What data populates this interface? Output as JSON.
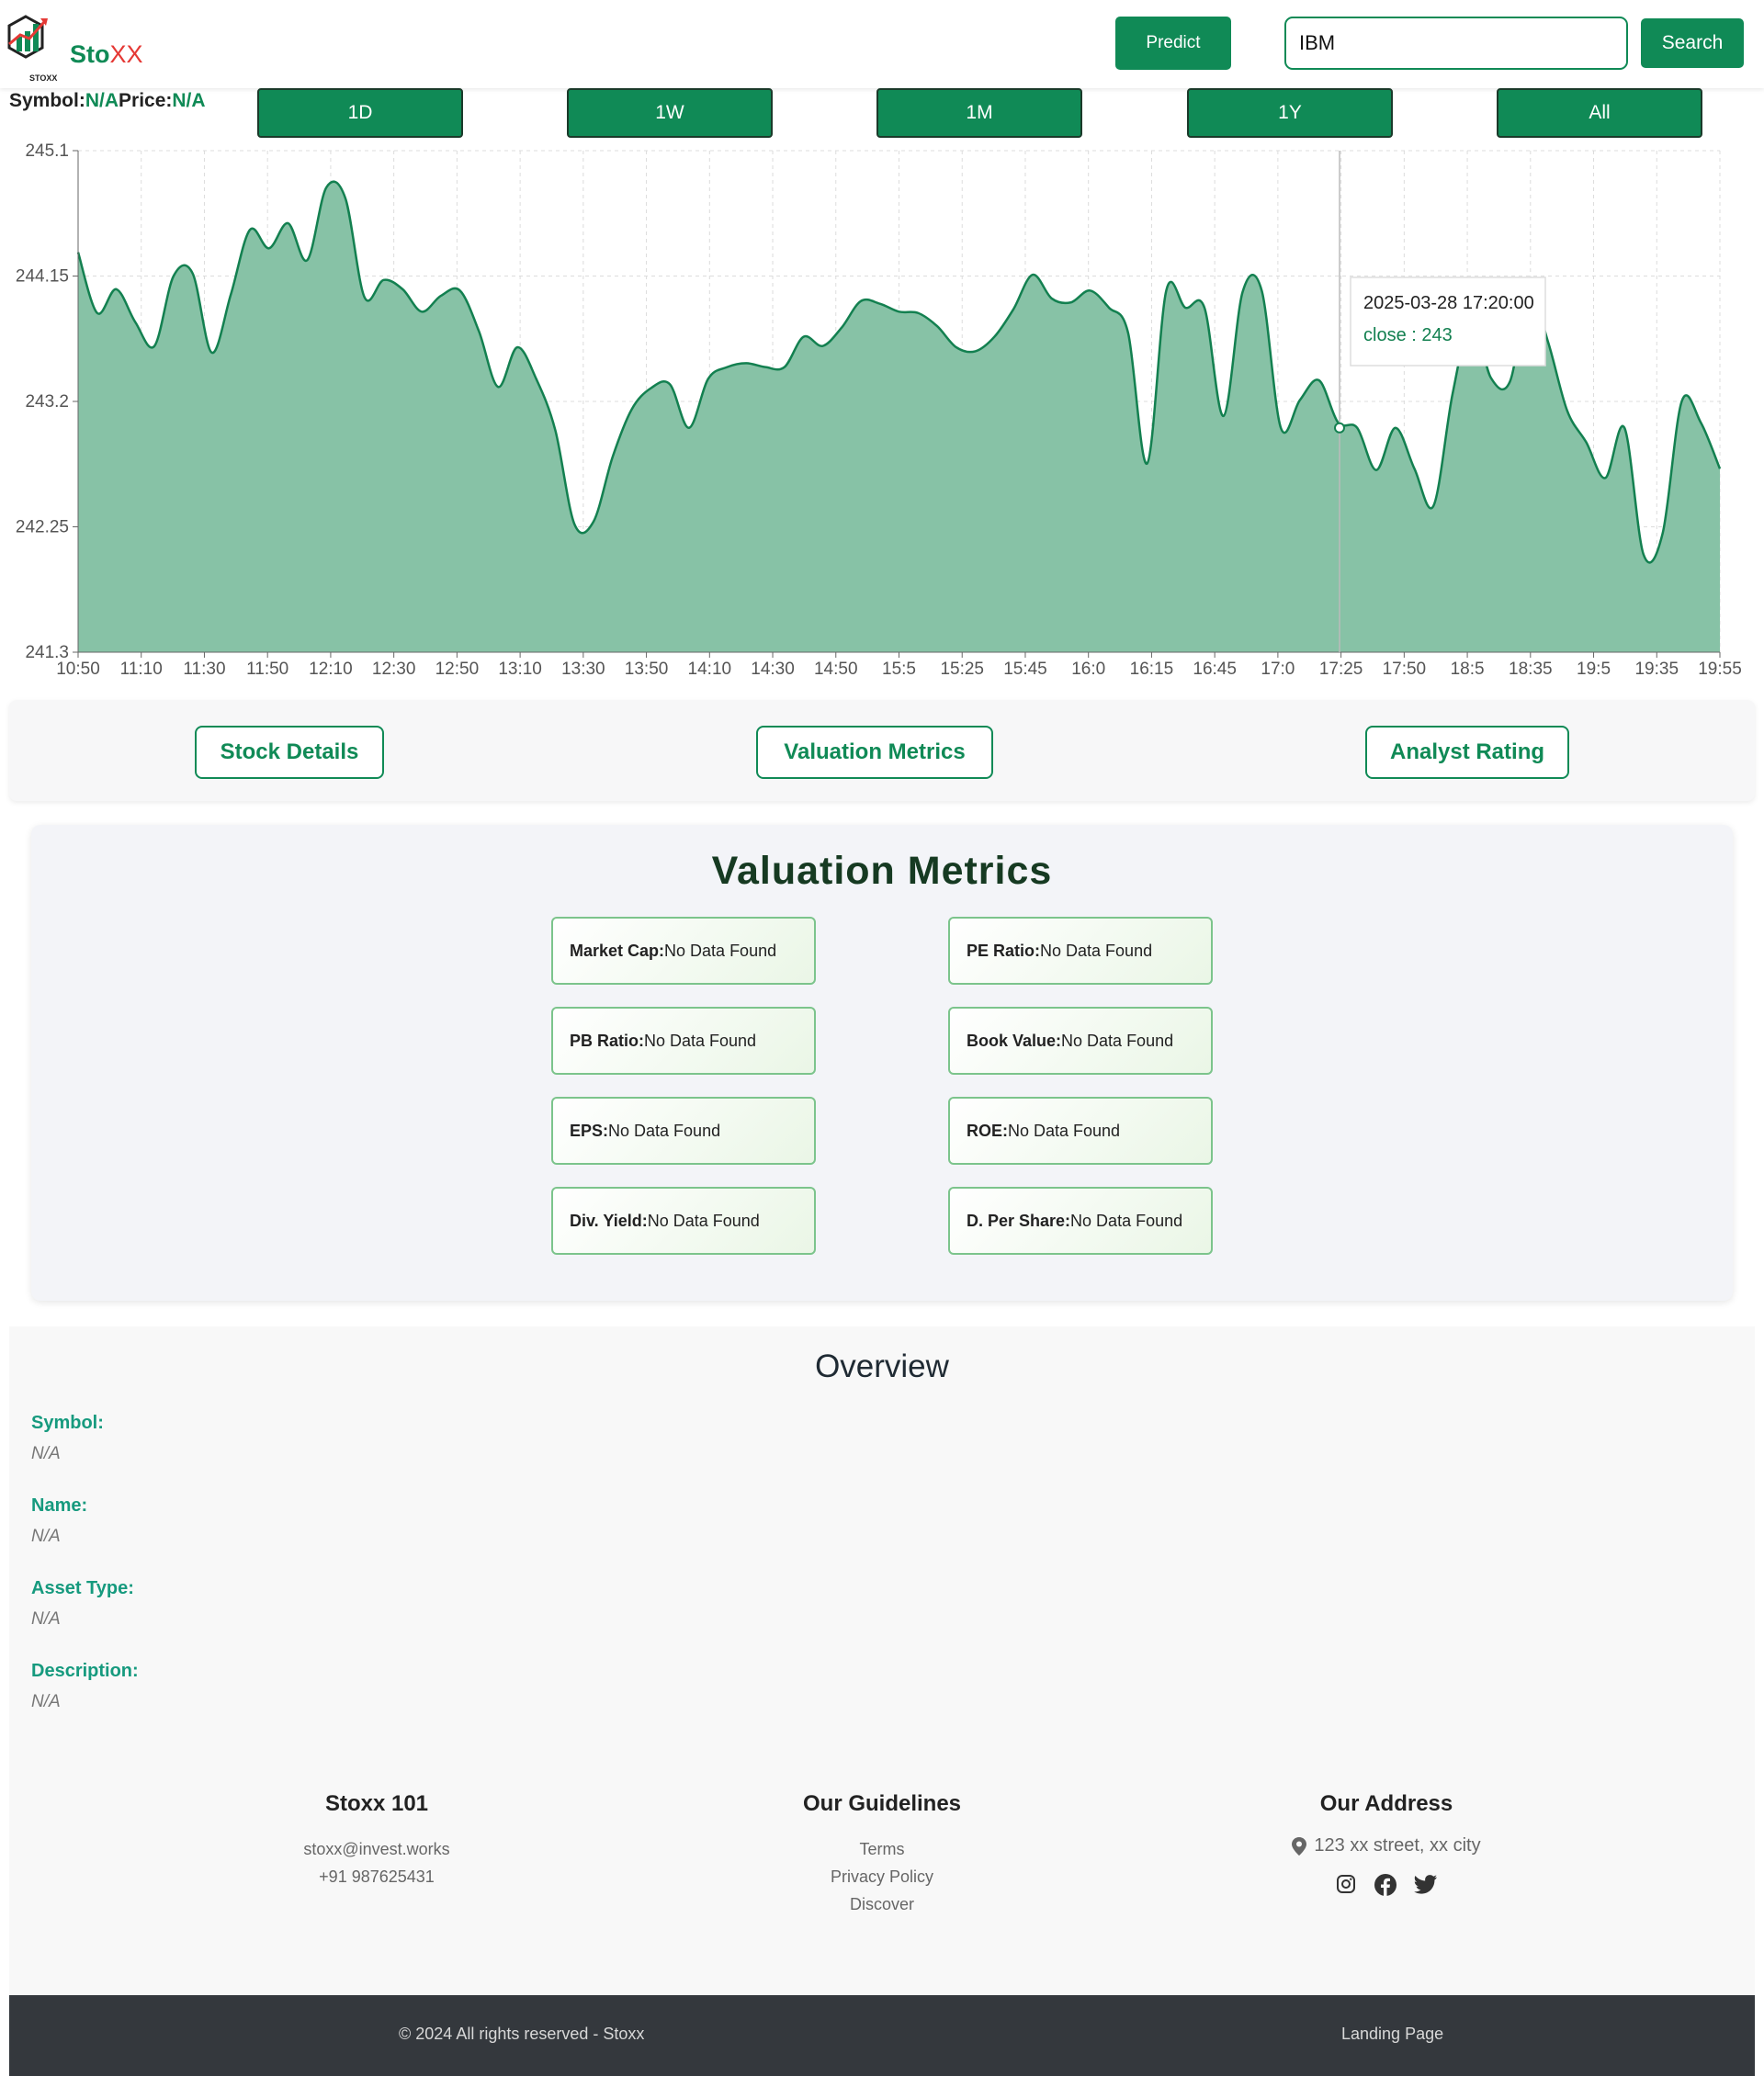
{
  "header": {
    "logo_text_a": "Sto",
    "logo_text_b": "XX",
    "logo_sub": "STOXX",
    "predict_label": "Predict",
    "search_value": "IBM",
    "search_label": "Search"
  },
  "quote": {
    "symbol_label": "Symbol:",
    "symbol_value": "N/A",
    "price_label": "Price:",
    "price_value": "N/A"
  },
  "ranges": [
    "1D",
    "1W",
    "1M",
    "1Y",
    "All"
  ],
  "colors": {
    "brand_green": "#108a56",
    "area_fill": "#87c2a6",
    "line": "#138050"
  },
  "chart_data": {
    "type": "area",
    "x": [
      "10:50",
      "11:10",
      "11:30",
      "11:50",
      "12:10",
      "12:30",
      "12:50",
      "13:10",
      "13:30",
      "13:50",
      "14:10",
      "14:30",
      "14:50",
      "15:5",
      "15:25",
      "15:45",
      "16:0",
      "16:15",
      "16:45",
      "17:0",
      "17:25",
      "17:50",
      "18:5",
      "18:35",
      "19:5",
      "19:35",
      "19:55"
    ],
    "y_ticks": [
      245.1,
      244.15,
      243.2,
      242.25,
      241.3
    ],
    "ylim": [
      241.3,
      245.1
    ],
    "grid": true,
    "series": [
      {
        "values": [
          244.33,
          243.87,
          244.05,
          243.8,
          243.62,
          244.15,
          244.17,
          243.57,
          244.01,
          244.5,
          244.36,
          244.55,
          244.27,
          244.82,
          244.74,
          243.99,
          244.12,
          244.05,
          243.88,
          244.0,
          244.04,
          243.73,
          243.31,
          243.61,
          243.37,
          242.98,
          242.27,
          242.29,
          242.78,
          243.14,
          243.3,
          243.33,
          243.0,
          243.37,
          243.46,
          243.49,
          243.46,
          243.46,
          243.69,
          243.62,
          243.76,
          243.96,
          243.94,
          243.88,
          243.87,
          243.77,
          243.61,
          243.58,
          243.69,
          243.9,
          244.16,
          243.98,
          243.95,
          244.04,
          243.91,
          243.72,
          242.73,
          244.04,
          243.91,
          243.91,
          243.09,
          244.03,
          244.04,
          243.0,
          243.21,
          243.36,
          243.04,
          243.0,
          242.68,
          243.0,
          242.69,
          242.41,
          243.26,
          243.82,
          243.38,
          243.35,
          244.03,
          243.65,
          243.13,
          242.89,
          242.62,
          243.0,
          242.04,
          242.2,
          243.2,
          243.04,
          242.69
        ]
      }
    ],
    "tooltip": {
      "date": "2025-03-28 17:20:00",
      "text": "close : 243"
    }
  },
  "tabs": [
    "Stock Details",
    "Valuation Metrics",
    "Analyst Rating"
  ],
  "valuation": {
    "title": "Valuation Metrics",
    "metrics": [
      {
        "label": "Market Cap:",
        "value": "No Data Found"
      },
      {
        "label": "PE Ratio:",
        "value": "No Data Found"
      },
      {
        "label": "PB Ratio:",
        "value": "No Data Found"
      },
      {
        "label": "Book Value:",
        "value": "No Data Found"
      },
      {
        "label": "EPS:",
        "value": "No Data Found"
      },
      {
        "label": "ROE:",
        "value": "No Data Found"
      },
      {
        "label": "Div. Yield:",
        "value": "No Data Found"
      },
      {
        "label": "D. Per Share:",
        "value": "No Data Found"
      }
    ]
  },
  "overview": {
    "title": "Overview",
    "fields": [
      {
        "label": "Symbol:",
        "value": "N/A"
      },
      {
        "label": "Name:",
        "value": "N/A"
      },
      {
        "label": "Asset Type:",
        "value": "N/A"
      },
      {
        "label": "Description:",
        "value": "N/A"
      }
    ]
  },
  "footer": {
    "col1": {
      "title": "Stoxx 101",
      "lines": [
        "stoxx@invest.works",
        "+91 987625431"
      ]
    },
    "col2": {
      "title": "Our Guidelines",
      "lines": [
        "Terms",
        "Privacy Policy",
        "Discover"
      ]
    },
    "col3": {
      "title": "Our Address",
      "address": "123 xx street, xx city",
      "social_icons": [
        "instagram-icon",
        "facebook-icon",
        "twitter-icon"
      ]
    },
    "copyright": "© 2024 All rights reserved - Stoxx",
    "landing": "Landing Page"
  }
}
